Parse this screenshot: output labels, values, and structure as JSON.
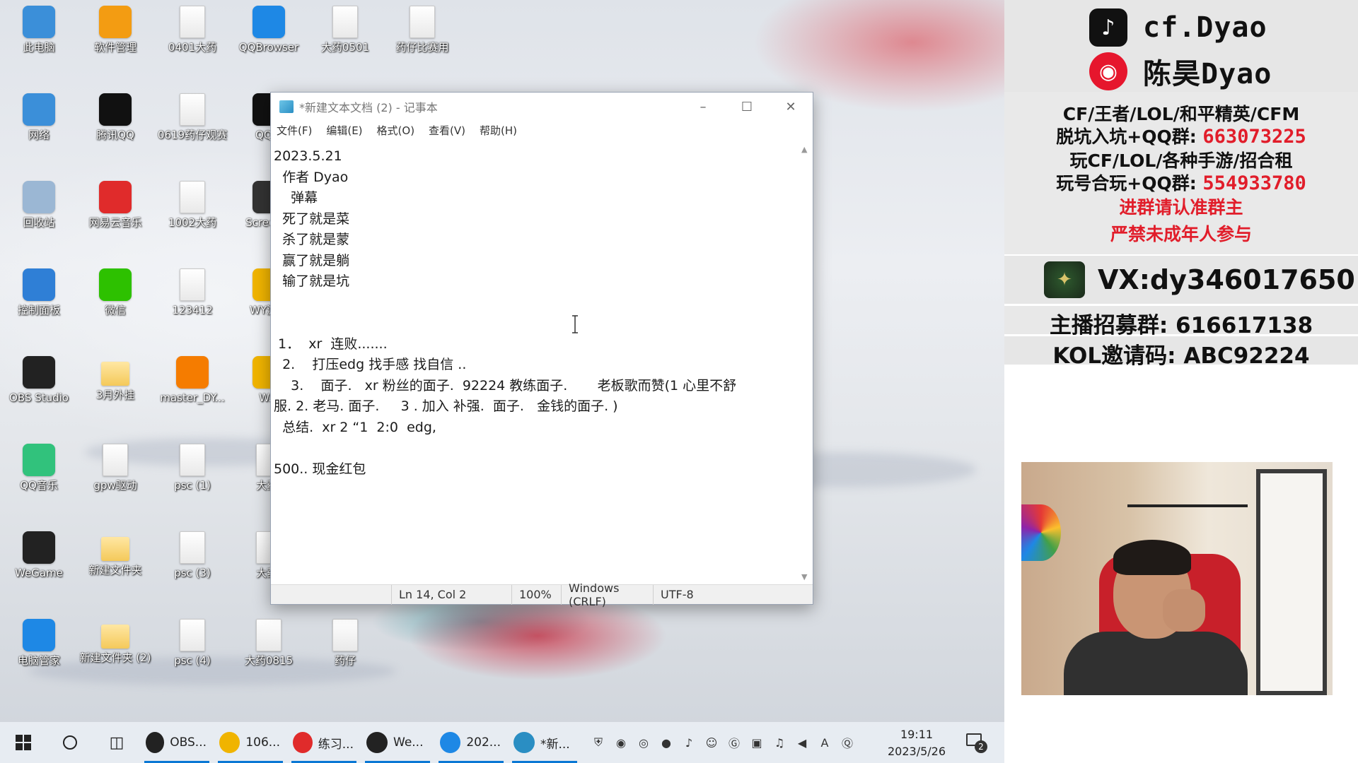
{
  "desktop": {
    "icons": [
      {
        "label": "此电脑",
        "icon": "computer-icon",
        "color": "#3b8fd9"
      },
      {
        "label": "软件管理",
        "icon": "app-manager-icon",
        "color": "#f39c12"
      },
      {
        "label": "0401大药",
        "icon": "file-icon",
        "color": "#ffffff"
      },
      {
        "label": "QQBrowser",
        "icon": "qqbrowser-icon",
        "color": "#1e88e5"
      },
      {
        "label": "大药0501",
        "icon": "file-icon",
        "color": "#ffffff"
      },
      {
        "label": "药仔比赛用",
        "icon": "image-file-icon",
        "color": "#ffffff"
      },
      {
        "label": "网络",
        "icon": "network-icon",
        "color": "#3b8fd9"
      },
      {
        "label": "腾讯QQ",
        "icon": "qq-penguin-icon",
        "color": "#111111"
      },
      {
        "label": "0619药仔观赛",
        "icon": "image-file-icon",
        "color": "#ffffff"
      },
      {
        "label": "QQ...",
        "icon": "qq-penguin-icon",
        "color": "#111111"
      },
      {
        "label": "回收站",
        "icon": "recycle-bin-icon",
        "color": "#9bb7d4"
      },
      {
        "label": "网易云音乐",
        "icon": "netease-music-icon",
        "color": "#e02b2b"
      },
      {
        "label": "1002大药",
        "icon": "file-icon",
        "color": "#ffffff"
      },
      {
        "label": "Screen...",
        "icon": "screen-icon",
        "color": "#333333"
      },
      {
        "label": "控制面板",
        "icon": "control-panel-icon",
        "color": "#2f7fd6"
      },
      {
        "label": "微信",
        "icon": "wechat-icon",
        "color": "#2dc100"
      },
      {
        "label": "123412",
        "icon": "file-icon",
        "color": "#ffffff"
      },
      {
        "label": "WY游戏",
        "icon": "game-icon",
        "color": "#f0b400"
      },
      {
        "label": "OBS Studio",
        "icon": "obs-icon",
        "color": "#222222"
      },
      {
        "label": "3月外挂",
        "icon": "folder-icon",
        "color": "#f4c95a"
      },
      {
        "label": "master_DY...",
        "icon": "douyu-icon",
        "color": "#f57c00"
      },
      {
        "label": "W...",
        "icon": "game-icon",
        "color": "#f0b400"
      },
      {
        "label": "QQ音乐",
        "icon": "qqmusic-icon",
        "color": "#31c27c"
      },
      {
        "label": "gpw驱动",
        "icon": "driver-icon",
        "color": "#ffffff"
      },
      {
        "label": "psc (1)",
        "icon": "image-file-icon",
        "color": "#ffffff"
      },
      {
        "label": "大药(",
        "icon": "file-icon",
        "color": "#ffffff"
      },
      {
        "label": "WeGame",
        "icon": "wegame-icon",
        "color": "#222222"
      },
      {
        "label": "新建文件夹",
        "icon": "folder-icon",
        "color": "#f4c95a"
      },
      {
        "label": "psc (3)",
        "icon": "image-file-icon",
        "color": "#7e57c2"
      },
      {
        "label": "大药(",
        "icon": "file-icon",
        "color": "#ffffff"
      },
      {
        "label": "电脑管家",
        "icon": "pc-manager-icon",
        "color": "#1e88e5"
      },
      {
        "label": "新建文件夹 (2)",
        "icon": "folder-icon",
        "color": "#f4c95a"
      },
      {
        "label": "psc (4)",
        "icon": "image-file-icon",
        "color": "#5e35b1"
      },
      {
        "label": "大药0815",
        "icon": "file-icon",
        "color": "#ffffff"
      },
      {
        "label": "药仔",
        "icon": "file-icon",
        "color": "#ffffff"
      }
    ]
  },
  "notepad": {
    "title": "*新建文本文档 (2) - 记事本",
    "menu": [
      "文件(F)",
      "编辑(E)",
      "格式(O)",
      "查看(V)",
      "帮助(H)"
    ],
    "lines": [
      "2023.5.21",
      "  作者 Dyao",
      "    弹幕",
      "  死了就是菜",
      "  杀了就是蒙",
      "  赢了就是躺",
      "  输了就是坑",
      "",
      "",
      " 1．  xr  连败.......",
      "  2.    打压edg 找手感 找自信 ..",
      "    3.    面子.   xr 粉丝的面子.  92224 教练面子.       老板歌而赞(1 心里不舒",
      "服. 2. 老马. 面子.     3 . 加入 补强.  面子.   金钱的面子. )",
      "  总结.  xr 2 “1  2:0  edg,",
      "",
      "500.. 现金红包"
    ],
    "status": {
      "position": "Ln 14,  Col 2",
      "zoom": "100%",
      "line_ending": "Windows (CRLF)",
      "encoding": "UTF-8"
    }
  },
  "taskbar": {
    "apps": [
      {
        "label": "OBS...",
        "icon": "obs-icon",
        "color": "#222222"
      },
      {
        "label": "106...",
        "icon": "game-icon",
        "color": "#f0b400"
      },
      {
        "label": "练习...",
        "icon": "netease-music-icon",
        "color": "#e02b2b"
      },
      {
        "label": "We...",
        "icon": "wegame-icon",
        "color": "#222222"
      },
      {
        "label": "202...",
        "icon": "qqbrowser-icon",
        "color": "#1e88e5"
      },
      {
        "label": "*新...",
        "icon": "notepad-icon",
        "color": "#2a8ec3"
      }
    ],
    "tray_icons": [
      "shield-icon",
      "gpw-icon",
      "netease-icon",
      "obs-tray-icon",
      "microphone-icon",
      "game-tray-icon",
      "wegame-tray-icon",
      "network-icon",
      "volume-icon",
      "speaker-icon",
      "ime-icon",
      "qq-tray-icon"
    ],
    "time": "19:11",
    "date": "2023/5/26",
    "notification_count": "2"
  },
  "overlay": {
    "douyin_name": "cf.Dyao",
    "weibo_name": "陈昊Dyao",
    "games_line": "CF/王者/LOL/和平精英/CFM",
    "group1_label": "脱坑入坑+QQ群: ",
    "group1_number": "663073225",
    "rent_line": "玩CF/LOL/各种手游/招合租",
    "group2_label": "玩号合玩+QQ群: ",
    "group2_number": "554933780",
    "notice1": "进群请认准群主",
    "notice2": "严禁未成年人参与",
    "vx": "VX:dy346017650",
    "recruit": "主播招募群:  616617138",
    "kol": "KOL邀请码:  ABC92224",
    "accent": "#e11d2a"
  }
}
